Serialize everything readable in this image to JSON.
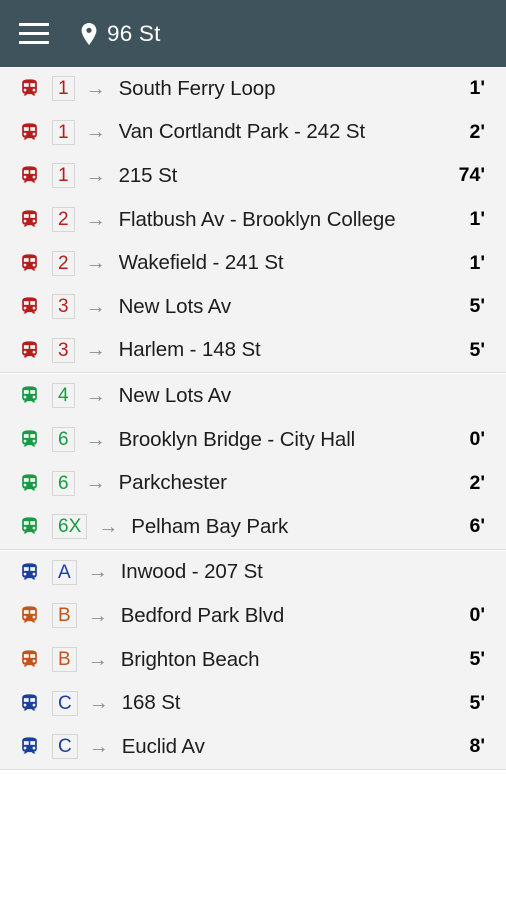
{
  "header": {
    "menu_icon": "hamburger-menu-icon",
    "location_icon": "map-pin-icon",
    "title": "96 St",
    "background_color": "#3f535c",
    "foreground_color": "#ffffff"
  },
  "colors": {
    "red": "#b81d1d",
    "green": "#189b45",
    "blue": "#1b3f9c",
    "orange": "#c2561a",
    "list_background": "#f3f3f3",
    "divider": "#dcdcdc",
    "arrow": "#8c8c8c",
    "destination_text": "#1d1d1d"
  },
  "list": {
    "train_icon": "subway-train-icon",
    "arrow_glyph": "→",
    "groups": [
      {
        "group_name": "red-lines-group",
        "rows": [
          {
            "line": "1",
            "color": "red",
            "destination": "South Ferry Loop",
            "eta": "1'"
          },
          {
            "line": "1",
            "color": "red",
            "destination": "Van Cortlandt Park - 242 St",
            "eta": "2'"
          },
          {
            "line": "1",
            "color": "red",
            "destination": "215 St",
            "eta": "74'"
          },
          {
            "line": "2",
            "color": "red",
            "destination": "Flatbush Av - Brooklyn College",
            "eta": "1'"
          },
          {
            "line": "2",
            "color": "red",
            "destination": "Wakefield - 241 St",
            "eta": "1'"
          },
          {
            "line": "3",
            "color": "red",
            "destination": "New Lots Av",
            "eta": "5'"
          },
          {
            "line": "3",
            "color": "red",
            "destination": "Harlem - 148 St",
            "eta": "5'"
          }
        ]
      },
      {
        "group_name": "green-lines-group",
        "rows": [
          {
            "line": "4",
            "color": "green",
            "destination": "New Lots Av",
            "eta": ""
          },
          {
            "line": "6",
            "color": "green",
            "destination": "Brooklyn Bridge - City Hall",
            "eta": "0'"
          },
          {
            "line": "6",
            "color": "green",
            "destination": "Parkchester",
            "eta": "2'"
          },
          {
            "line": "6X",
            "color": "green",
            "destination": "Pelham Bay Park",
            "eta": "6'"
          }
        ]
      },
      {
        "group_name": "lettered-lines-group",
        "rows": [
          {
            "line": "A",
            "color": "blue",
            "destination": "Inwood - 207 St",
            "eta": ""
          },
          {
            "line": "B",
            "color": "orange",
            "destination": "Bedford Park Blvd",
            "eta": "0'"
          },
          {
            "line": "B",
            "color": "orange",
            "destination": "Brighton Beach",
            "eta": "5'"
          },
          {
            "line": "C",
            "color": "blue",
            "destination": "168 St",
            "eta": "5'"
          },
          {
            "line": "C",
            "color": "blue",
            "destination": "Euclid Av",
            "eta": "8'"
          }
        ]
      }
    ]
  }
}
